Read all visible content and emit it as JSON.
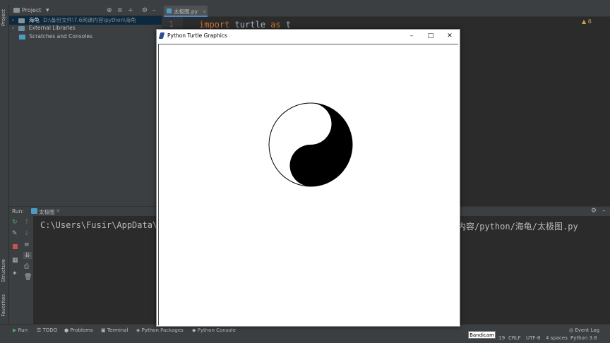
{
  "left_strip": {
    "project_tab": "Project",
    "structure_tab": "Structure",
    "favorites_tab": "Favorites"
  },
  "project_panel": {
    "title": "Project",
    "tree": [
      {
        "name": "海龟",
        "path": "D:\\备份文件\\7.6网课内容\\python\\海龟",
        "selected": true
      },
      {
        "name": "External Libraries"
      },
      {
        "name": "Scratches and Consoles"
      }
    ]
  },
  "editor": {
    "tab_label": "太极图.py",
    "line_number": "1",
    "code_line": {
      "keyword1": "import",
      "module": " turtle ",
      "keyword2": "as",
      "alias": " t"
    },
    "warnings_count": "6"
  },
  "run_panel": {
    "label": "Run:",
    "tab_label": "太极图",
    "console_left": "C:\\Users\\Fusir\\AppData\\",
    "console_right": "课内容/python/海龟/太极图.py"
  },
  "turtle_window": {
    "title": "Python Turtle Graphics",
    "minimize": "–",
    "maximize": "□",
    "close": "✕"
  },
  "status_bar": {
    "run": "Run",
    "todo": "TODO",
    "problems": "Problems",
    "terminal": "Terminal",
    "python_packages": "Python Packages",
    "python_console": "Python Console",
    "event_log": "Event Log",
    "position": ":19",
    "line_sep": "CRLF",
    "encoding": "UTF-8",
    "indent": "4 spaces",
    "interpreter": "Python 3.8"
  },
  "watermark": "Bandicam",
  "colors": {
    "keyword": "#cc7832",
    "selection": "#0d293e",
    "accent": "#4a88c7"
  }
}
